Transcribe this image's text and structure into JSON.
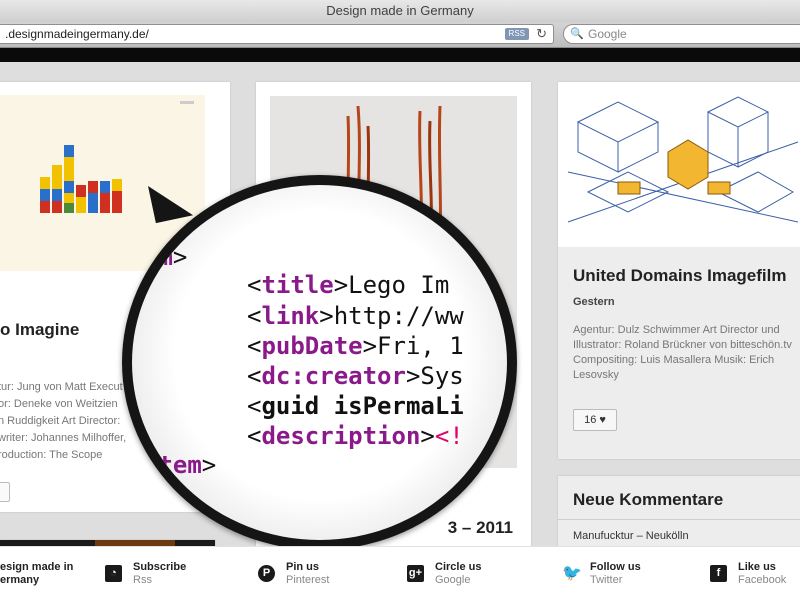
{
  "window": {
    "title": "Design made in Germany"
  },
  "browser": {
    "url": ".designmadeingermany.de/",
    "rss_badge": "RSS",
    "search_placeholder": "Google"
  },
  "cards": [
    {
      "title": "o Imagine",
      "credits": [
        "tur: Jung von Matt Execut",
        "or: Deneke von Weitzien",
        "n Ruddigkeit Art Director:",
        "writer: Johannes Milhoffer,",
        "roduction: The Scope"
      ],
      "like": "♥"
    },
    {
      "title": "3 – 2011"
    },
    {
      "title": "United Domains Imagefilm",
      "date": "Gestern",
      "credits": "Agentur: Dulz Schwimmer Art Director und Illustrator: Roland Brückner von bitteschön.tv Compositing: Luis Masallera Musik: Erich Lesovsky",
      "likes": "16 ♥"
    }
  ],
  "comments": {
    "title": "Neue Kommentare",
    "first_item": "Manufucktur – Neukölln"
  },
  "magnifier": {
    "lines": [
      {
        "parts": [
          [
            "tag",
            "em"
          ],
          [
            "br",
            ">"
          ]
        ]
      },
      {
        "parts": [
          [
            "br",
            "<"
          ],
          [
            "tag",
            "title"
          ],
          [
            "br",
            ">Lego Im"
          ]
        ]
      },
      {
        "parts": [
          [
            "br",
            "<"
          ],
          [
            "tag",
            "link"
          ],
          [
            "br",
            ">http://ww"
          ]
        ]
      },
      {
        "parts": [
          [
            "br",
            "<"
          ],
          [
            "tag",
            "pubDate"
          ],
          [
            "br",
            ">Fri, 1"
          ]
        ]
      },
      {
        "parts": [
          [
            "br",
            "<"
          ],
          [
            "tag",
            "dc:creator"
          ],
          [
            "br",
            ">Sys"
          ]
        ]
      },
      {
        "parts": [
          [
            "br",
            "<"
          ],
          [
            "b",
            "guid isPermaLi"
          ]
        ]
      },
      {
        "parts": [
          [
            "br",
            "<"
          ],
          [
            "tag",
            "description"
          ],
          [
            "br",
            ">"
          ],
          [
            "red",
            "<!"
          ]
        ]
      },
      {
        "parts": [
          [
            "tag",
            "item"
          ],
          [
            "br",
            ">"
          ]
        ]
      }
    ]
  },
  "footer": {
    "brand": [
      "esign made in",
      "ermany"
    ],
    "items": [
      {
        "label": "Subscribe",
        "sub": "Rss",
        "icon": "rss-icon"
      },
      {
        "label": "Pin us",
        "sub": "Pinterest",
        "icon": "pinterest-icon"
      },
      {
        "label": "Circle us",
        "sub": "Google",
        "icon": "google-plus-icon"
      },
      {
        "label": "Follow us",
        "sub": "Twitter",
        "icon": "twitter-icon"
      },
      {
        "label": "Like us",
        "sub": "Facebook",
        "icon": "facebook-icon"
      }
    ]
  },
  "colors": {
    "tag_purple": "#8a1a8a",
    "accent_red": "#e0006a",
    "page_bg": "#dedede"
  }
}
